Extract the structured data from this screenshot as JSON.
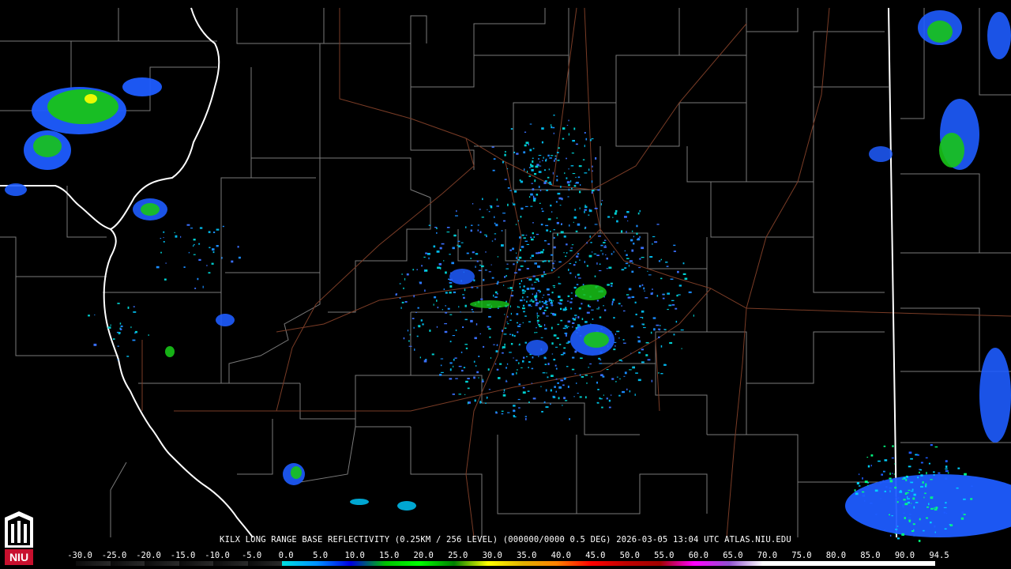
{
  "product": {
    "caption": "KILX LONG RANGE BASE REFLECTIVITY (0.25KM / 256 LEVEL) (000000/0000 0.5 DEG) 2026-03-05 13:04 UTC  ATLAS.NIU.EDU"
  },
  "legend": {
    "labels": [
      "-30.0",
      "-25.0",
      "-20.0",
      "-15.0",
      "-10.0",
      "-5.0",
      "0.0",
      "5.0",
      "10.0",
      "15.0",
      "20.0",
      "25.0",
      "30.0",
      "35.0",
      "40.0",
      "45.0",
      "50.0",
      "55.0",
      "60.0",
      "65.0",
      "70.0",
      "75.0",
      "80.0",
      "85.0",
      "90.0",
      "94.5"
    ],
    "colors": [
      "#000000",
      "#000000",
      "#000000",
      "#000000",
      "#000000",
      "#000000",
      "#00e0e0",
      "#0090ff",
      "#0000e0",
      "#00c000",
      "#00ff00",
      "#008000",
      "#ffff00",
      "#e0b000",
      "#ff8000",
      "#ff0000",
      "#c00000",
      "#a00000",
      "#ff00ff",
      "#9050d0",
      "#ffffff",
      "#ffffff",
      "#ffffff",
      "#ffffff",
      "#ffffff"
    ]
  },
  "colors": {
    "background": "#000000",
    "county_lines": "#8a8a8a",
    "state_lines": "#ffffff",
    "highways": "#8b4a30",
    "logo_red": "#c8102e"
  },
  "logo": {
    "text": "NIU"
  }
}
